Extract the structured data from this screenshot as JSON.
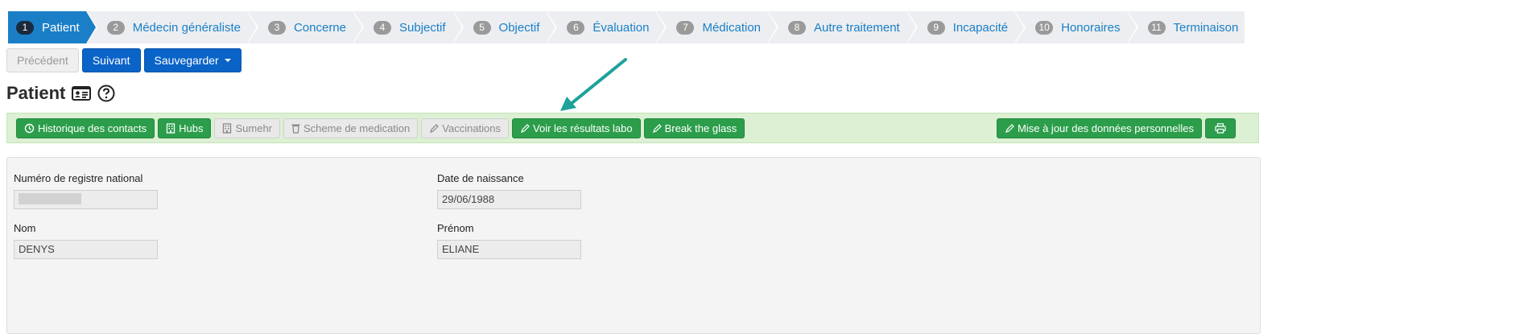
{
  "wizard": {
    "steps": [
      {
        "num": "1",
        "label": "Patient"
      },
      {
        "num": "2",
        "label": "Médecin généraliste"
      },
      {
        "num": "3",
        "label": "Concerne"
      },
      {
        "num": "4",
        "label": "Subjectif"
      },
      {
        "num": "5",
        "label": "Objectif"
      },
      {
        "num": "6",
        "label": "Évaluation"
      },
      {
        "num": "7",
        "label": "Médication"
      },
      {
        "num": "8",
        "label": "Autre traitement"
      },
      {
        "num": "9",
        "label": "Incapacité"
      },
      {
        "num": "10",
        "label": "Honoraires"
      },
      {
        "num": "11",
        "label": "Terminaison"
      }
    ],
    "buttons": {
      "previous": "Précédent",
      "next": "Suivant",
      "save": "Sauvegarder"
    }
  },
  "page": {
    "title": "Patient"
  },
  "toolbar": {
    "contact_history": "Historique des contacts",
    "hubs": "Hubs",
    "sumehr": "Sumehr",
    "medication_scheme": "Scheme de medication",
    "vaccinations": "Vaccinations",
    "lab_results": "Voir les résultats labo",
    "break_glass": "Break the glass",
    "update_personal": "Mise à jour des données personnelles"
  },
  "form": {
    "national_id": {
      "label": "Numéro de registre national",
      "value": ""
    },
    "birth_date": {
      "label": "Date de naissance",
      "value": "29/06/1988"
    },
    "last_name": {
      "label": "Nom",
      "value": "DENYS"
    },
    "first_name": {
      "label": "Prénom",
      "value": "ELIANE"
    }
  },
  "colors": {
    "primary": "#0a63c7",
    "success": "#2c9e4b",
    "toolbar_bg": "#dcf0d3",
    "arrow": "#1fa29b"
  }
}
